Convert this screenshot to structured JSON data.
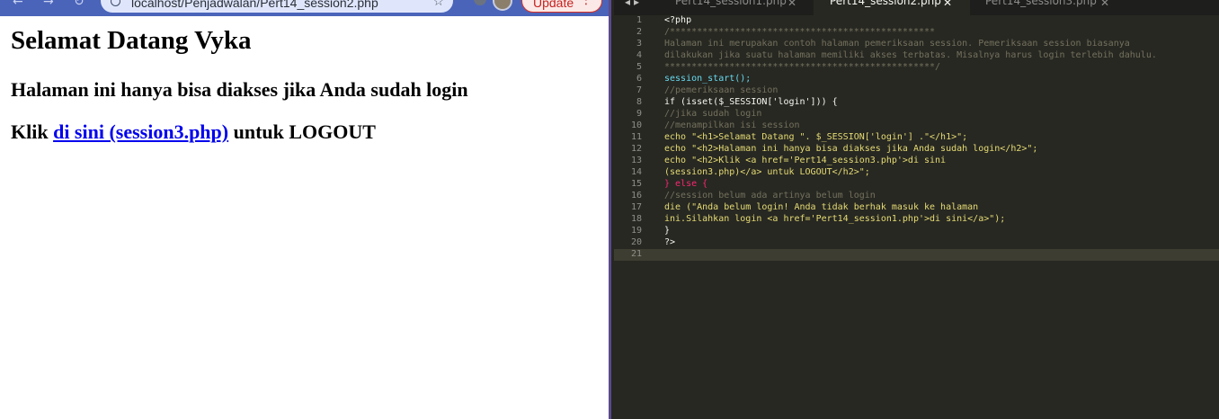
{
  "browser": {
    "url": "localhost/Penjadwalan/Pert14_session2.php",
    "update_label": "Update",
    "page": {
      "heading": "Selamat Datang Vyka",
      "subheading": "Halaman ini hanya bisa diakses jika Anda sudah login",
      "logout_prefix": "Klik",
      "logout_link": "di sini (session3.php)",
      "logout_suffix": "untuk LOGOUT"
    }
  },
  "editor": {
    "tabs": [
      {
        "name": "Pert14_session1.php",
        "active": false
      },
      {
        "name": "Pert14_session2.php",
        "active": true
      },
      {
        "name": "Pert14_session3.php",
        "active": false
      }
    ],
    "line_numbers": [
      "1",
      "2",
      "3",
      "4",
      "5",
      "6",
      "7",
      "8",
      "9",
      "10",
      "11",
      "12",
      "13",
      "14",
      "15",
      "16",
      "17",
      "18",
      "19",
      "20",
      "21"
    ],
    "code": {
      "l1": "<?php",
      "l2": "/*************************************************",
      "l3": "Halaman ini merupakan contoh halaman pemeriksaan session. Pemeriksaan session biasanya",
      "l4": "dilakukan jika suatu halaman memiliki akses terbatas. Misalnya harus login terlebih dahulu.",
      "l5": "**************************************************/",
      "l6": "session_start();",
      "l7": "//pemeriksaan session",
      "l8": "if (isset($_SESSION['login'])) {",
      "l9": "//jika sudah login",
      "l10": "//menampilkan isi session",
      "l11": "echo \"<h1>Selamat Datang \". $_SESSION['login'] .\"</h1>\";",
      "l12": "echo \"<h2>Halaman ini hanya bisa diakses jika Anda sudah login</h2>\";",
      "l13": "echo \"<h2>Klik <a href='Pert14_session3.php'>di sini",
      "l14": "(session3.php)</a> untuk LOGOUT</h2>\";",
      "l15": "} else {",
      "l16": "//session belum ada artinya belum login",
      "l17": "die (\"Anda belum login! Anda tidak berhak masuk ke halaman",
      "l18": "ini.Silahkan login <a href='Pert14_session1.php'>di sini</a>\");",
      "l19": "}",
      "l20": "?>",
      "l21": ""
    }
  },
  "colors": {
    "editor_bg": "#272822",
    "comment": "#75715e",
    "keyword": "#f92672",
    "function": "#66d9ef",
    "string": "#e6db74",
    "link": "#0000ee"
  }
}
